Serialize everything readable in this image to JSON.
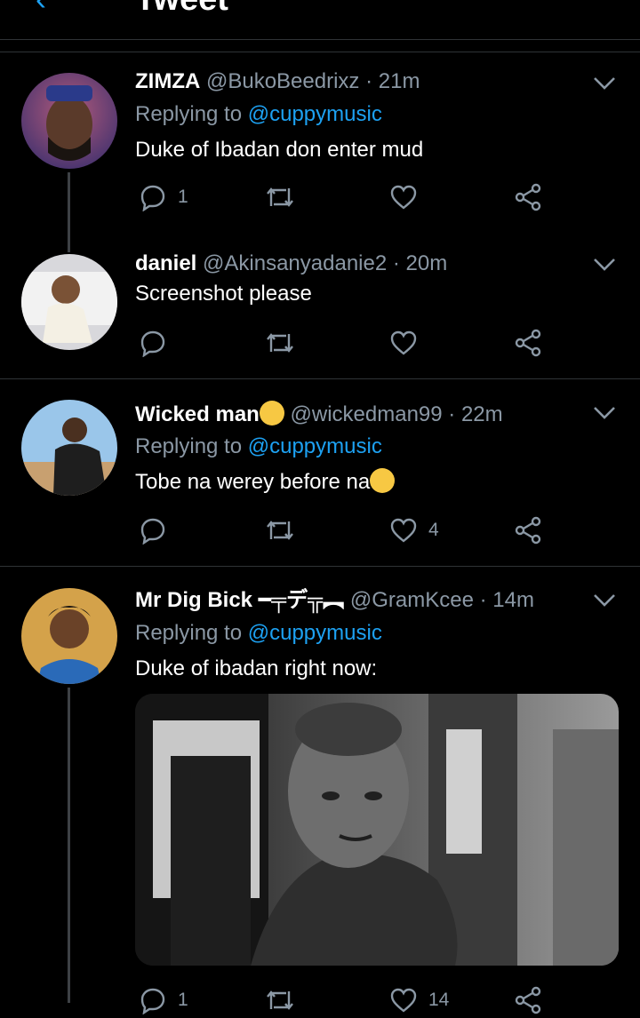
{
  "header": {
    "title": "Tweet",
    "back_icon": "back-arrow-icon"
  },
  "colors": {
    "background": "#000000",
    "accent": "#1da1f2",
    "muted": "#8b98a5",
    "separator": "#2f3336"
  },
  "tweets": [
    {
      "name": "ZIMZA",
      "handle": "@BukoBeedrixz",
      "dot": "·",
      "time": "21m",
      "replying_prefix": "Replying to",
      "replying_to": "@cuppymusic",
      "text": "Duke of Ibadan don enter mud",
      "reply_count": "1",
      "retweet_count": "",
      "like_count": ""
    },
    {
      "name": "daniel",
      "handle": "@Akinsanyadanie2",
      "dot": "·",
      "time": "20m",
      "text": "Screenshot please",
      "reply_count": "",
      "retweet_count": "",
      "like_count": ""
    },
    {
      "name": "Wicked man",
      "name_emoji": "zany-face-emoji",
      "handle": "@wickedman99",
      "dot": "·",
      "time": "22m",
      "replying_prefix": "Replying to",
      "replying_to": "@cuppymusic",
      "text": "Tobe na werey before na",
      "text_emoji": "laughing-tears-emoji",
      "reply_count": "",
      "retweet_count": "",
      "like_count": "4"
    },
    {
      "name": "Mr Dig Bick",
      "name_suffix": "━╤デ╦︻",
      "handle": "@GramKcee",
      "dot": "·",
      "time": "14m",
      "replying_prefix": "Replying to",
      "replying_to": "@cuppymusic",
      "text": "Duke of ibadan right now:",
      "reply_count": "1",
      "retweet_count": "",
      "like_count": "14"
    }
  ]
}
